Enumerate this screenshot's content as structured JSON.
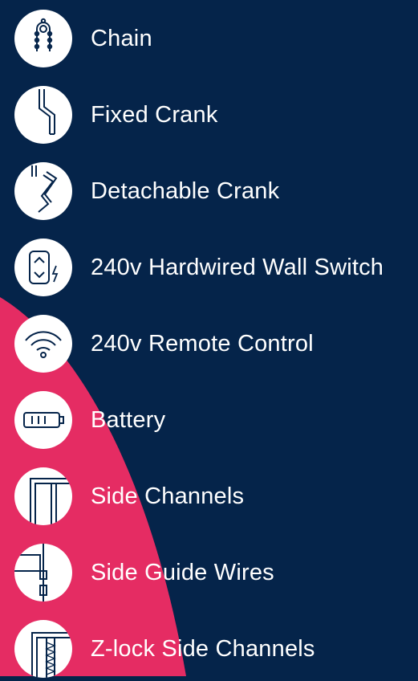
{
  "colors": {
    "background": "#05244a",
    "accent": "#e52c63",
    "icon_bg": "#ffffff",
    "icon_stroke": "#05244a",
    "text": "#ffffff"
  },
  "features": [
    {
      "label": "Chain",
      "icon": "chain-icon"
    },
    {
      "label": "Fixed Crank",
      "icon": "fixed-crank-icon"
    },
    {
      "label": "Detachable Crank",
      "icon": "detachable-crank-icon"
    },
    {
      "label": "240v Hardwired Wall Switch",
      "icon": "wall-switch-icon"
    },
    {
      "label": "240v Remote Control",
      "icon": "remote-control-icon"
    },
    {
      "label": "Battery",
      "icon": "battery-icon"
    },
    {
      "label": "Side Channels",
      "icon": "side-channels-icon"
    },
    {
      "label": "Side Guide Wires",
      "icon": "side-guide-wires-icon"
    },
    {
      "label": "Z-lock Side Channels",
      "icon": "z-lock-side-channels-icon"
    }
  ]
}
